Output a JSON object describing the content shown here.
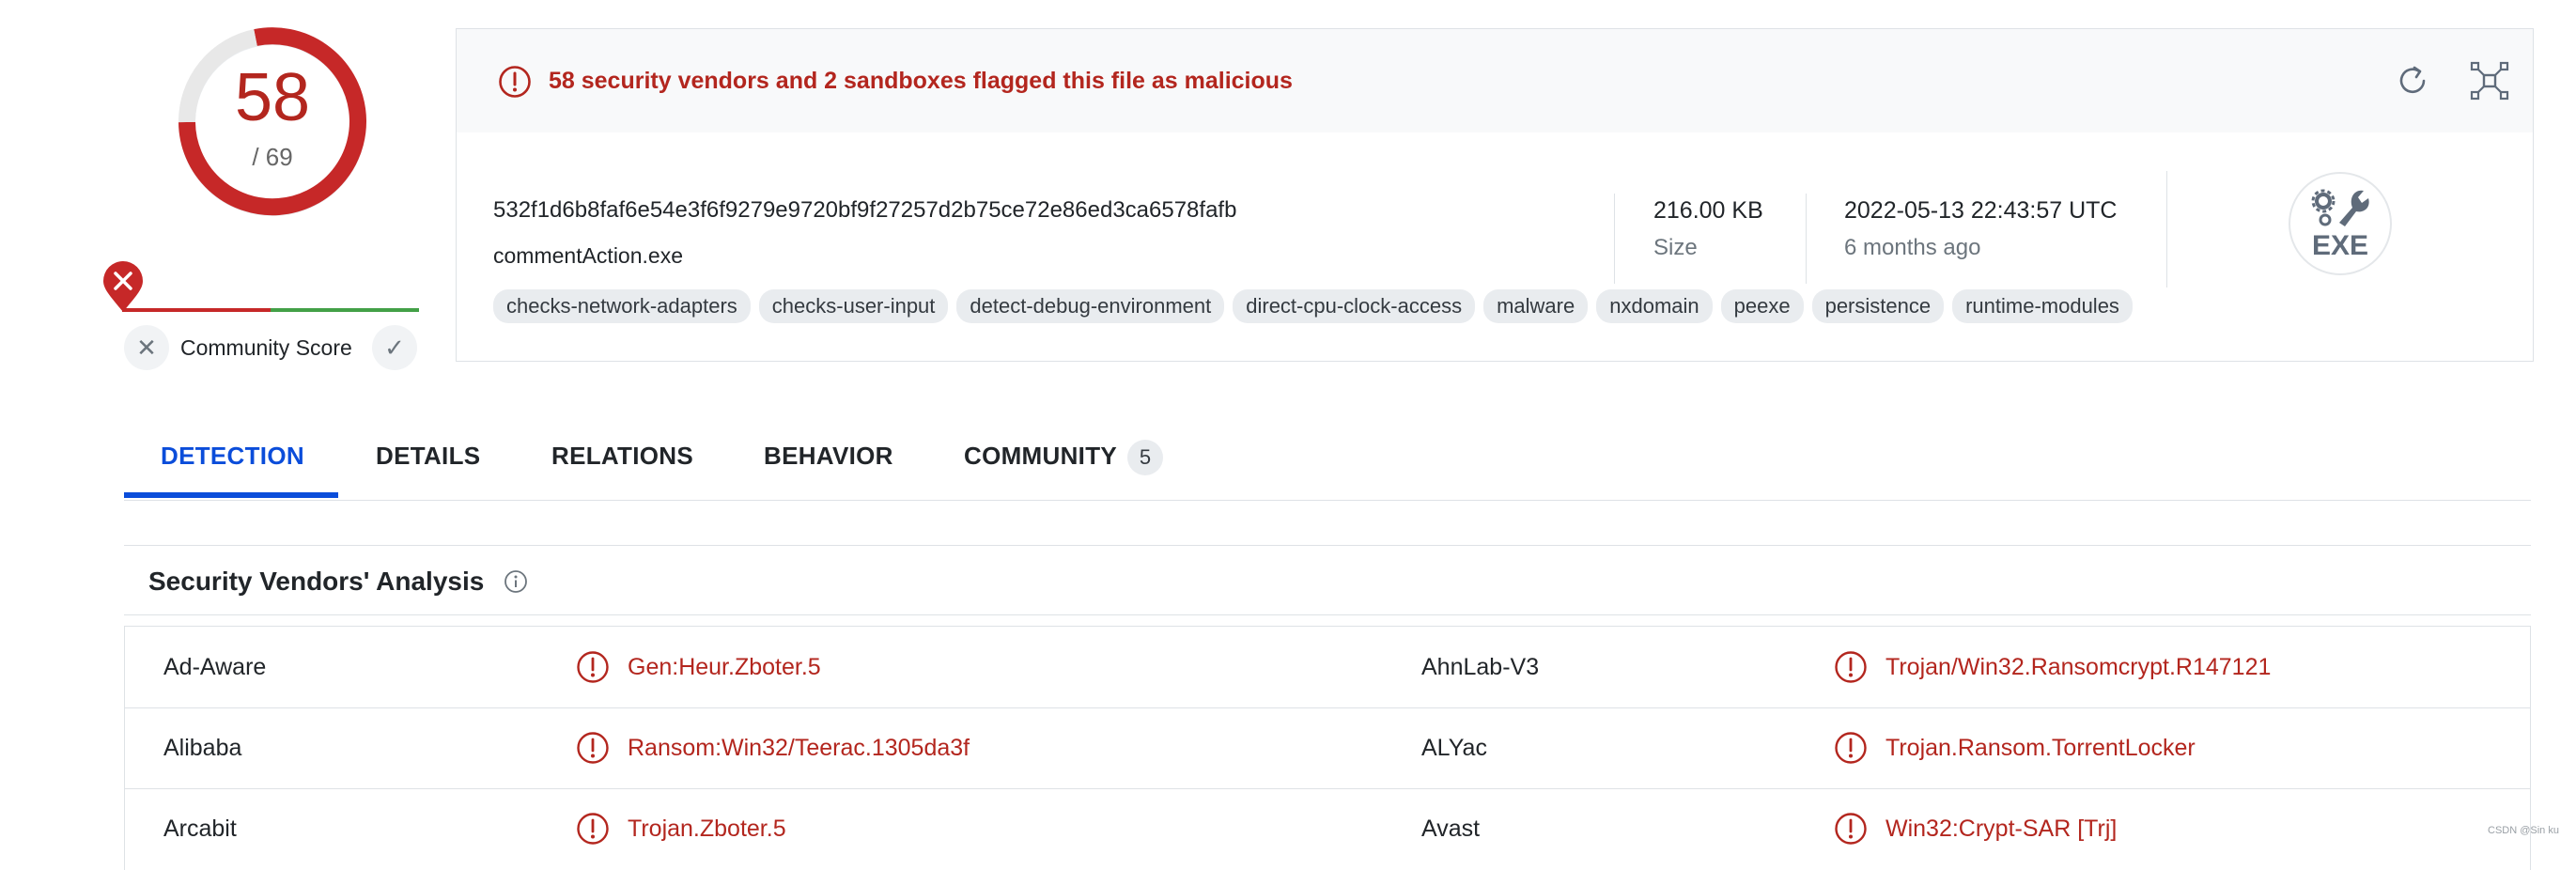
{
  "score": {
    "detections": "58",
    "total": "/ 69"
  },
  "community": {
    "label": "Community Score"
  },
  "alert": {
    "text": "58 security vendors and 2 sandboxes flagged this file as malicious"
  },
  "file": {
    "hash": "532f1d6b8faf6e54e3f6f9279e9720bf9f27257d2b75ce72e86ed3ca6578fafb",
    "name": "commentAction.exe",
    "size": "216.00 KB",
    "size_label": "Size",
    "date": "2022-05-13 22:43:57 UTC",
    "date_relative": "6 months ago",
    "type_label": "EXE",
    "tags": [
      "checks-network-adapters",
      "checks-user-input",
      "detect-debug-environment",
      "direct-cpu-clock-access",
      "malware",
      "nxdomain",
      "peexe",
      "persistence",
      "runtime-modules"
    ]
  },
  "tabs": [
    {
      "label": "DETECTION",
      "active": true
    },
    {
      "label": "DETAILS"
    },
    {
      "label": "RELATIONS"
    },
    {
      "label": "BEHAVIOR"
    },
    {
      "label": "COMMUNITY",
      "badge": "5"
    }
  ],
  "analysis": {
    "title": "Security Vendors' Analysis",
    "rows": [
      {
        "vendor1": "Ad-Aware",
        "result1": "Gen:Heur.Zboter.5",
        "vendor2": "AhnLab-V3",
        "result2": "Trojan/Win32.Ransomcrypt.R147121"
      },
      {
        "vendor1": "Alibaba",
        "result1": "Ransom:Win32/Teerac.1305da3f",
        "vendor2": "ALYac",
        "result2": "Trojan.Ransom.TorrentLocker"
      },
      {
        "vendor1": "Arcabit",
        "result1": "Trojan.Zboter.5",
        "vendor2": "Avast",
        "result2": "Win32:Crypt-SAR [Trj]"
      }
    ]
  },
  "watermark": "CSDN @Sin ku",
  "colors": {
    "malicious": "#b3261e",
    "accent": "#0b4dda",
    "gauge_track": "#e9ecef",
    "community_red": "#c62828",
    "community_green": "#43a047"
  },
  "icons": [
    "alert-circle-icon",
    "refresh-icon",
    "graph-icon",
    "close-icon",
    "check-icon",
    "info-icon",
    "exe-file-icon",
    "community-marker-icon"
  ]
}
